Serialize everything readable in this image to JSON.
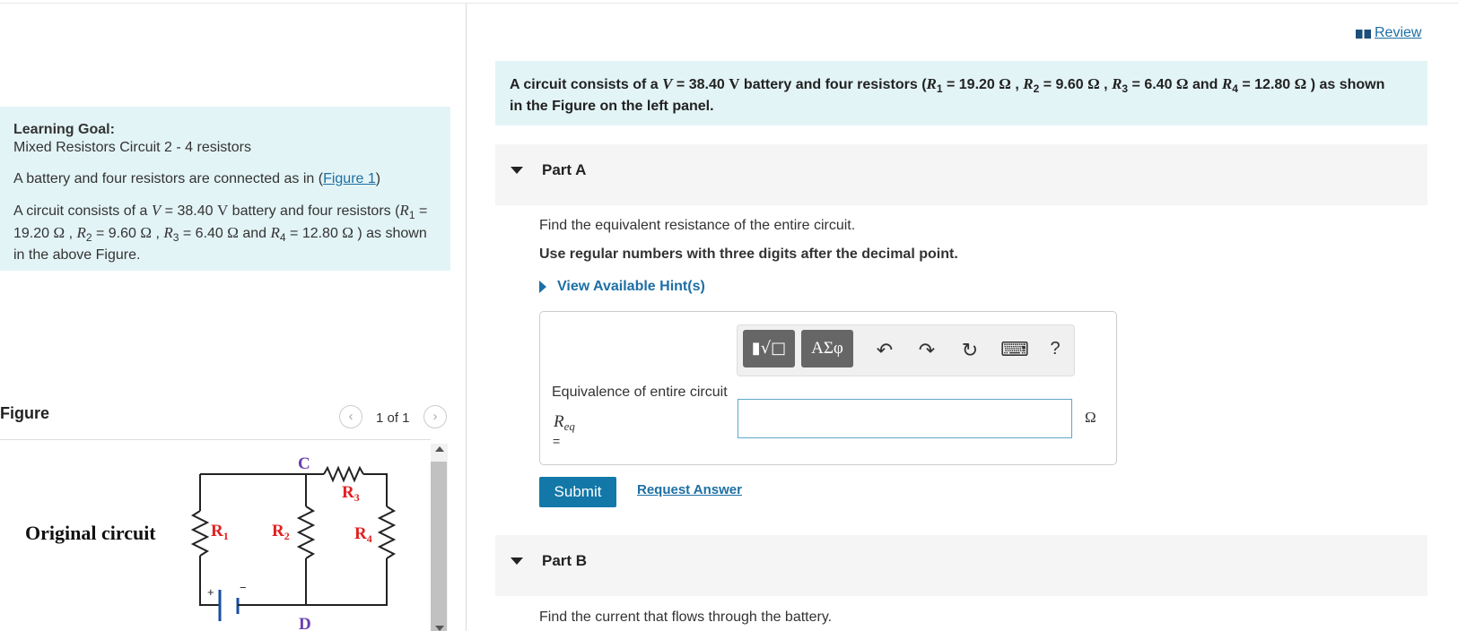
{
  "header": {
    "review_label": "Review"
  },
  "left": {
    "goal_title": "Learning Goal:",
    "goal_subtitle": "Mixed Resistors Circuit 2 - 4 resistors",
    "goal_p1_text": "A battery and four resistors are connected as in (",
    "goal_p1_link": "Figure 1",
    "goal_p1_end": ")",
    "goal_p2": {
      "t1": "A circuit consists of a ",
      "v_sym": "V",
      "t2": " = 38.40 ",
      "v_unit": "V",
      "t3": " battery and four resistors (",
      "r1_sym": "R",
      "r1_sub": "1",
      "r1_val": " = 19.20 ",
      "u1": "Ω",
      "c1": " , ",
      "r2_sym": "R",
      "r2_sub": "2",
      "r2_val": " = 9.60 ",
      "u2": "Ω",
      "c2": " , ",
      "r3_sym": "R",
      "r3_sub": "3",
      "r3_val": " = 6.40 ",
      "u3": "Ω",
      "c3": " and ",
      "r4_sym": "R",
      "r4_sub": "4",
      "r4_val": " = 12.80 ",
      "u4": "Ω",
      "end": " ) as shown in the  above Figure."
    },
    "figure": {
      "heading": "Figure",
      "prev_icon": "‹",
      "next_icon": "›",
      "pager_text": "1 of 1",
      "caption": "Original circuit",
      "node_c": "C",
      "node_d": "D",
      "r1": "R",
      "r1_sub": "1",
      "r2": "R",
      "r2_sub": "2",
      "r3": "R",
      "r3_sub": "3",
      "r4": "R",
      "r4_sub": "4",
      "plus": "+",
      "minus": "−"
    }
  },
  "right": {
    "intro": {
      "t1": "A circuit consists of a ",
      "v_sym": "V",
      "t2": " = 38.40 ",
      "v_unit": "V",
      "t3": " battery and four resistors (",
      "r1_sym": "R",
      "r1_sub": "1",
      "r1_val": " = 19.20 ",
      "u1": "Ω",
      "c1": " , ",
      "r2_sym": "R",
      "r2_sub": "2",
      "r2_val": " = 9.60 ",
      "u2": "Ω",
      "c2": " , ",
      "r3_sym": "R",
      "r3_sub": "3",
      "r3_val": " = 6.40 ",
      "u3": "Ω",
      "c3": " and ",
      "r4_sym": "R",
      "r4_sub": "4",
      "r4_val": " = 12.80 ",
      "u4": "Ω",
      "end": " ) as shown in the Figure on the left panel."
    },
    "part_a": {
      "title": "Part A",
      "question": "Find the equivalent resistance of the entire circuit.",
      "instruction": "Use regular numbers with three digits after the decimal point.",
      "hint_label": "View Available Hint(s)",
      "toolbar": {
        "templates_icon": "▮√□",
        "symbols_label": "ΑΣφ",
        "undo_icon": "↶",
        "redo_icon": "↷",
        "reset_icon": "↻",
        "keyboard_icon": "⌨",
        "help_label": "?"
      },
      "answer_label": "Equivalence of entire circuit",
      "var_sym": "R",
      "var_sub": "eq",
      "equals": "=",
      "answer_value": "",
      "unit": "Ω",
      "submit_label": "Submit",
      "request_label": "Request Answer"
    },
    "part_b": {
      "title": "Part B",
      "question": "Find the current that flows through the battery."
    }
  },
  "colors": {
    "accent": "#1d6fa5",
    "submit": "#1378a8",
    "panel_bg": "#e3f4f6",
    "resistor_label": "#e02020",
    "node_label": "#6a3fb0"
  }
}
